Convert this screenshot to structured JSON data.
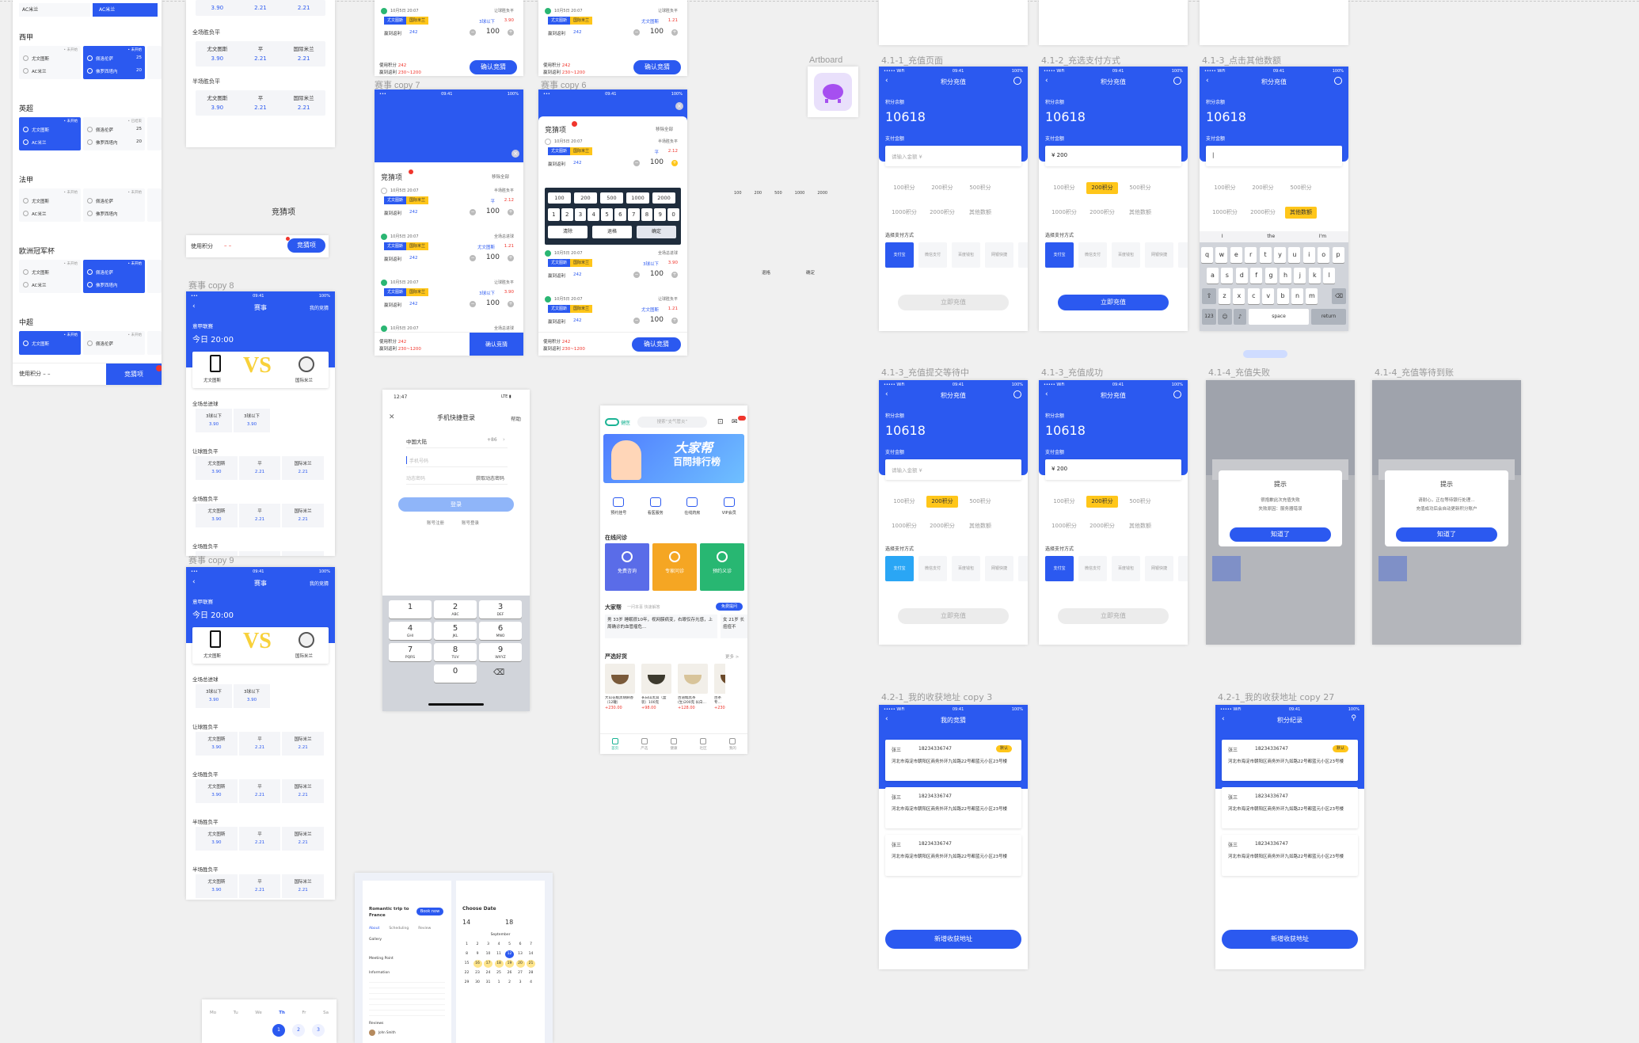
{
  "a1": {
    "labels": [
      "AC米兰",
      "AC米兰"
    ],
    "leagues": [
      "西甲",
      "英超",
      "法甲",
      "欧洲冠军杯",
      "中超"
    ],
    "status_open": "• 未开始",
    "status_ended": "• 已结束",
    "teams": [
      "尤文图斯",
      "AC米兰",
      "佩洛伦萨",
      "佛罗西塔内"
    ],
    "scores": [
      "25",
      "20"
    ],
    "bottom_label": "使用积分 – –",
    "bottom_btn": "竞猜项"
  },
  "a2": {
    "odds": [
      "3.90",
      "2.21",
      "2.21"
    ],
    "titles": [
      "全场胜负平",
      "半场胜负平"
    ],
    "cells": [
      "尤文图斯",
      "平",
      "国际米兰"
    ]
  },
  "label_jcx": "竞猜项",
  "a3": {
    "label": "使用积分",
    "dash": "– –",
    "btn": "竞猜项"
  },
  "copy7": {
    "label": "赛事 copy 7",
    "title": "竞猜项",
    "clear": "移除全部",
    "date": "10月5日 20:07",
    "type1": "半场胜负平",
    "type2": "全场总进球",
    "type3": "让球胜负平",
    "team1": "尤文图斯",
    "team2": "国际米兰",
    "pick1": "平",
    "pick2": "尤文图斯",
    "pick3": "3球以下",
    "odd1": "2.12",
    "odd2": "1.21",
    "odd3": "3.90",
    "income": "赢到返利",
    "income_val": "242",
    "num": "100",
    "used": "使用积分",
    "used_val": "242",
    "range": "230~1200",
    "confirm": "确认竞猜"
  },
  "copy6": {
    "label": "赛事 copy 6",
    "title": "竞猜项",
    "clear": "移除全部",
    "preset": [
      "100",
      "200",
      "500",
      "1000",
      "2000"
    ],
    "digits": [
      "1",
      "2",
      "3",
      "4",
      "5",
      "6",
      "7",
      "8",
      "9",
      "0"
    ],
    "actions": [
      "清除",
      "退格",
      "确定"
    ]
  },
  "copy8": {
    "label": "赛事 copy 8",
    "label9": "赛事 copy 9",
    "title": "赛事",
    "right": "我的竞猜",
    "league": "意甲联赛",
    "time": "今日 20:00",
    "vs": "VS",
    "home": "尤文图斯",
    "away": "国际米兰",
    "sections": [
      "全场总进球",
      "让球胜负平",
      "全场胜负平",
      "半场胜负平"
    ],
    "goals": [
      "3球以下",
      "3球以下"
    ],
    "goal_odds": [
      "3.90",
      "3.90"
    ],
    "odds": [
      "3.90",
      "2.21",
      "2.21"
    ],
    "picks": [
      "尤文图斯",
      "平",
      "国际米兰"
    ]
  },
  "login": {
    "time": "12:47",
    "title": "手机快捷登录",
    "help": "帮助",
    "region": "中国大陆",
    "code": "+86",
    "phone_ph": "手机号码",
    "code_ph": "动态密码",
    "get_code": "获取动态密码",
    "login": "登录",
    "links": [
      "账号注册",
      "账号登录"
    ],
    "keys": [
      [
        "1",
        ""
      ],
      [
        "2",
        "ABC"
      ],
      [
        "3",
        "DEF"
      ],
      [
        "4",
        "GHI"
      ],
      [
        "5",
        "JKL"
      ],
      [
        "6",
        "MNO"
      ],
      [
        "7",
        "PQRS"
      ],
      [
        "8",
        "TUV"
      ],
      [
        "9",
        "WXYZ"
      ],
      [
        "0",
        ""
      ]
    ]
  },
  "health": {
    "search_ph": "搜索“支气管炎”",
    "banner1": "大家帮",
    "banner2": "百問排行榜",
    "icons": [
      "预约挂号",
      "看医服务",
      "在线药房",
      "VIP会员"
    ],
    "sec1": "在线问诊",
    "cards": [
      "免费咨询",
      "专家问诊",
      "预约义诊"
    ],
    "sec2": "大家帮",
    "sec2_sub": "一问本喜 快速解答",
    "sec2_btn": "免费提问",
    "q1": "男 33岁 睡眠很10年，视网膜病变，右眼仅存光感，上周确诊的血管瘤危…",
    "q2": "女 21岁 长痘痘不",
    "sec3": "严选好货",
    "more": "更多 >",
    "goods": [
      "大山花椒黑胡麻香（12罐）",
      "长白山黑茸（盒装）100克",
      "古道糯黑茶(生)200克 长白…",
      "古茶专…"
    ],
    "prices": [
      "+230.00",
      "+98.00",
      "+128.00",
      "+230."
    ],
    "tabs": [
      "首页",
      "严选",
      "健康",
      "社区",
      "我的"
    ]
  },
  "artboard": {
    "label": "Artboard"
  },
  "tiny": {
    "nums": [
      "100",
      "200",
      "500",
      "1000",
      "2000"
    ],
    "backspace": "退格",
    "ok": "确定"
  },
  "recharge": [
    {
      "label": "4.1-1_充值页面",
      "title": "积分充值",
      "bal_label": "积分余额",
      "bal": "10618",
      "amt_label": "支付金额",
      "amt_ph": "请输入金额 ¥",
      "amt": "",
      "chips": [
        "100积分",
        "200积分",
        "500积分",
        "1000积分",
        "2000积分",
        "其他数额"
      ],
      "sel": -1,
      "pay_label": "选择支付方式",
      "pays": [
        "支付宝",
        "微信支付",
        "百度钱包",
        "网银快捷",
        "银行"
      ],
      "btn": "立即充值",
      "active": false
    },
    {
      "label": "4.1-2_充选支付方式",
      "title": "积分充值",
      "bal_label": "积分余额",
      "bal": "10618",
      "amt_label": "支付金额",
      "amt_ph": "",
      "amt": "¥ 200",
      "chips": [
        "100积分",
        "200积分",
        "500积分",
        "1000积分",
        "2000积分",
        "其他数额"
      ],
      "sel": 1,
      "pay_label": "选择支付方式",
      "pays": [
        "支付宝",
        "微信支付",
        "百度钱包",
        "网银快捷",
        "银行"
      ],
      "btn": "立即充值",
      "active": true
    },
    {
      "label": "4.1-3_点击其他数额",
      "title": "积分充值",
      "bal_label": "积分余额",
      "bal": "10618",
      "amt_label": "支付金额",
      "amt_ph": "",
      "amt": "|",
      "chips": [
        "100积分",
        "200积分",
        "500积分",
        "1000积分",
        "2000积分",
        "其他数额"
      ],
      "sel": 5,
      "pay_label": "",
      "pays": [],
      "btn": "",
      "active": false
    },
    {
      "label": "4.1-3_充值提交等待中",
      "title": "积分充值",
      "bal_label": "积分余额",
      "bal": "10618",
      "amt_label": "支付金额",
      "amt_ph": "请输入金额 ¥",
      "amt": "",
      "chips": [
        "100积分",
        "200积分",
        "500积分",
        "1000积分",
        "2000积分",
        "其他数额"
      ],
      "sel": 1,
      "pay_label": "选择支付方式",
      "pays": [
        "支付宝",
        "微信支付",
        "百度钱包",
        "网银快捷",
        "银行"
      ],
      "btn": "立即充值",
      "active": false
    },
    {
      "label": "4.1-3_充值成功",
      "title": "积分充值",
      "bal_label": "积分余额",
      "bal": "10618",
      "amt_label": "支付金额",
      "amt_ph": "",
      "amt": "¥ 200",
      "chips": [
        "100积分",
        "200积分",
        "500积分",
        "1000积分",
        "2000积分",
        "其他数额"
      ],
      "sel": 1,
      "pay_label": "选择支付方式",
      "pays": [
        "支付宝",
        "微信支付",
        "百度钱包",
        "网银快捷",
        "银行"
      ],
      "btn": "立即充值",
      "active": false
    }
  ],
  "kb": {
    "sugg": [
      "I",
      "the",
      "I'm"
    ],
    "r1": [
      "q",
      "w",
      "e",
      "r",
      "t",
      "y",
      "u",
      "i",
      "o",
      "p"
    ],
    "r2": [
      "a",
      "s",
      "d",
      "f",
      "g",
      "h",
      "j",
      "k",
      "l"
    ],
    "r3": [
      "z",
      "x",
      "c",
      "v",
      "b",
      "n",
      "m"
    ],
    "num": "123",
    "space": "space",
    "ret": "return"
  },
  "fail": [
    {
      "label": "4.1-4_充值失败",
      "title": "提示",
      "msg1": "很抱歉此次充值失败",
      "msg2": "失败原因：服务器错误",
      "btn": "知道了"
    },
    {
      "label": "4.1-4_充值等待到账",
      "title": "提示",
      "msg1": "请耐心，正在等待银行处理…",
      "msg2": "充值成功后会自动更新积分账户",
      "btn": "知道了"
    }
  ],
  "addr": [
    {
      "label": "4.2-1_我的收获地址 copy 3",
      "title": "我的竞猜",
      "add": "新增收获地址"
    },
    {
      "label": "4.2-1_我的收获地址 copy 27",
      "title": "积分纪录",
      "add": "新增收获地址"
    }
  ],
  "addr_items": {
    "name": "张三",
    "phone": "18234336747",
    "tag": "默认",
    "addr": "河北市海淀市朝阳区商务外环九如路22号都蓝元小区23号楼"
  },
  "trip": {
    "title": "Romantic trip to France",
    "book": "Book now",
    "tabs": [
      "About",
      "Scheduling",
      "Review"
    ],
    "gallery": "Gallery",
    "meeting": "Meeting Point",
    "info": "Information",
    "reviews": "Reviews",
    "date_title": "Choose Date",
    "month": "September",
    "start": "14",
    "end": "18",
    "reviewer": "John Smith"
  },
  "cal": {
    "days": [
      "Mo",
      "Tu",
      "We",
      "Th",
      "Fr",
      "Sa"
    ],
    "nums": [
      "1",
      "2",
      "3"
    ]
  }
}
